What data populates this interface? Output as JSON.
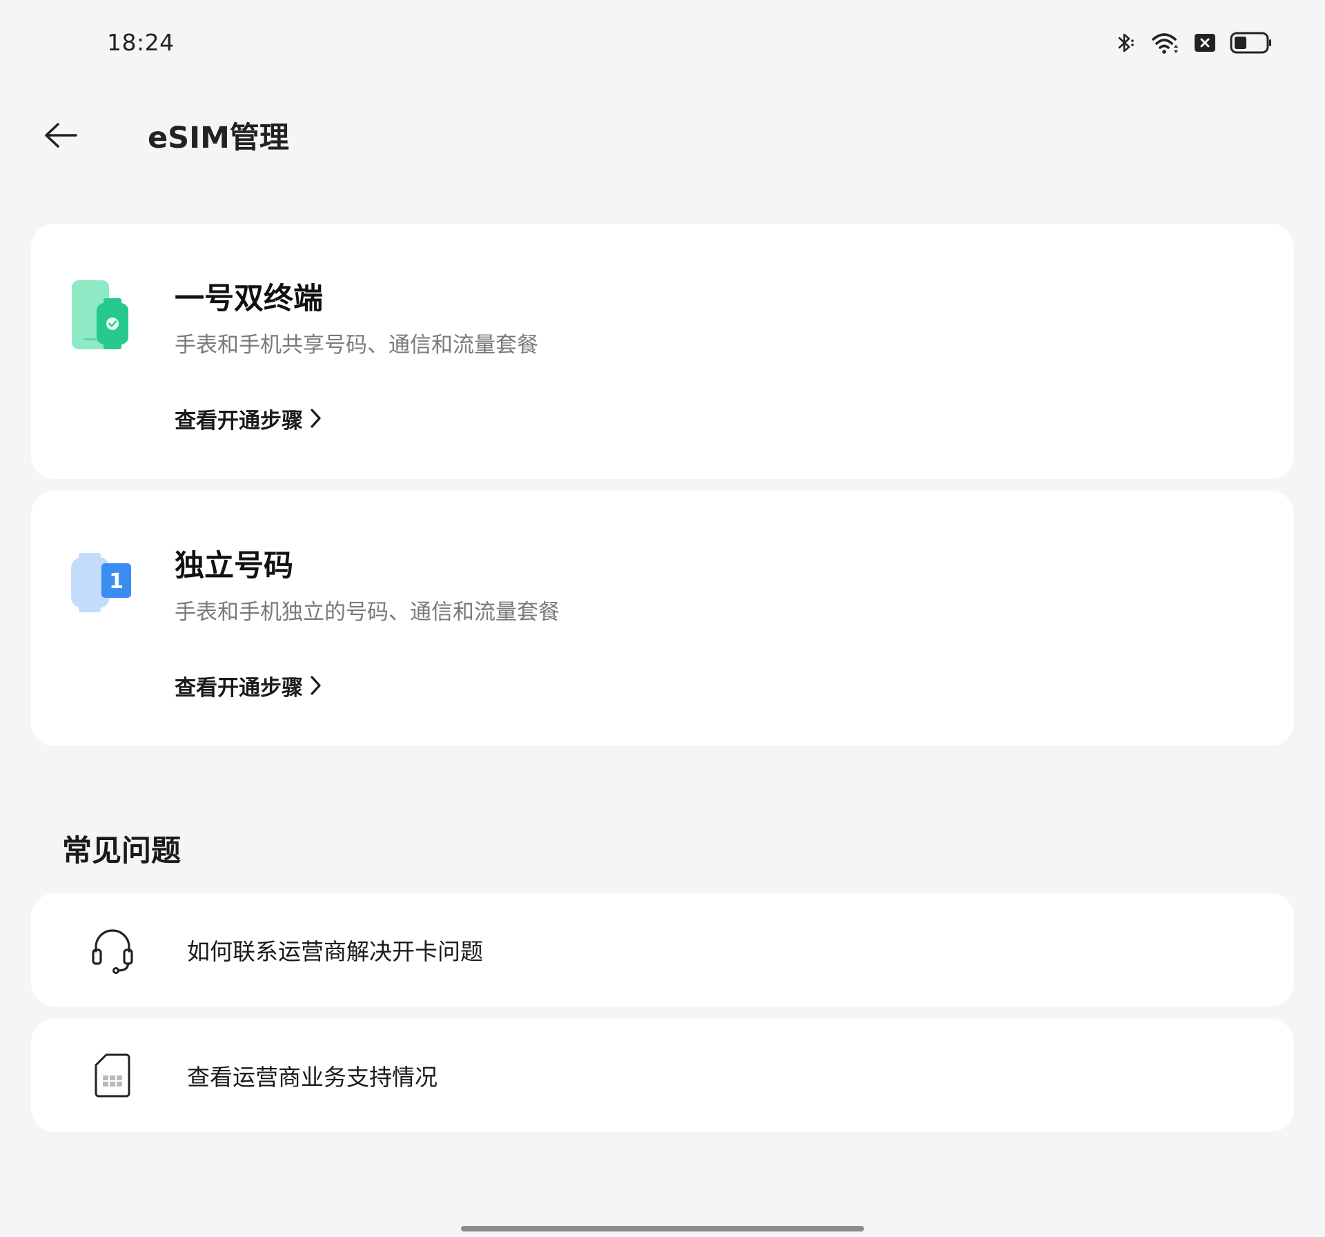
{
  "status_bar": {
    "time": "18:24"
  },
  "header": {
    "title": "eSIM管理"
  },
  "cards": [
    {
      "title": "一号双终端",
      "description": "手表和手机共享号码、通信和流量套餐",
      "link_label": "查看开通步骤"
    },
    {
      "title": "独立号码",
      "description": "手表和手机独立的号码、通信和流量套餐",
      "link_label": "查看开通步骤",
      "badge_number": "1"
    }
  ],
  "faq": {
    "title": "常见问题",
    "items": [
      {
        "label": "如何联系运营商解决开卡问题"
      },
      {
        "label": "查看运营商业务支持情况"
      }
    ]
  },
  "colors": {
    "background": "#f5f5f5",
    "card": "#ffffff",
    "green_light": "#8ee9c5",
    "green": "#26c98b",
    "blue_light": "#c4dcfb",
    "blue": "#3b8cf0"
  }
}
